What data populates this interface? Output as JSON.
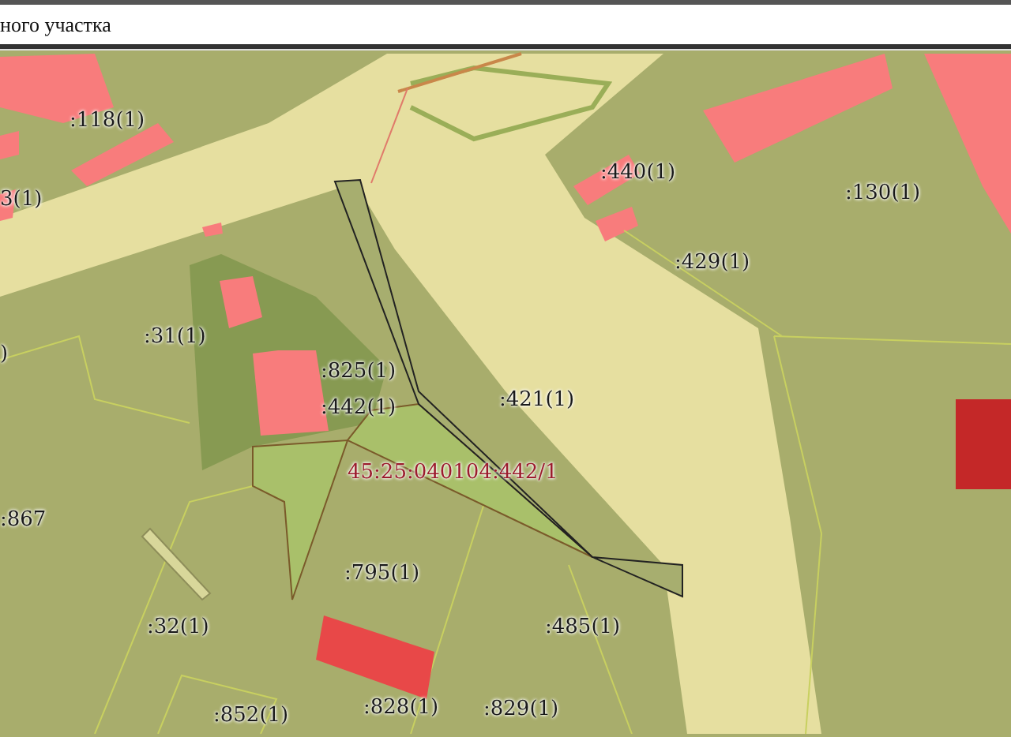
{
  "header": {
    "title": "ного участка"
  },
  "map": {
    "labels": [
      {
        "text": ":118(1)",
        "kind": "parcel"
      },
      {
        "text": "3(1)",
        "kind": "parcel"
      },
      {
        "text": ":440(1)",
        "kind": "parcel"
      },
      {
        "text": ":130(1)",
        "kind": "parcel"
      },
      {
        "text": ":429(1)",
        "kind": "parcel"
      },
      {
        "text": ":31(1)",
        "kind": "parcel"
      },
      {
        "text": ")",
        "kind": "parcel"
      },
      {
        "text": ":825(1)",
        "kind": "parcel"
      },
      {
        "text": ":442(1)",
        "kind": "parcel"
      },
      {
        "text": ":421(1)",
        "kind": "parcel"
      },
      {
        "text": "45:25:040104:442/1",
        "kind": "selected"
      },
      {
        "text": ":867",
        "kind": "parcel"
      },
      {
        "text": ":795(1)",
        "kind": "parcel"
      },
      {
        "text": ":32(1)",
        "kind": "parcel"
      },
      {
        "text": ":485(1)",
        "kind": "parcel"
      },
      {
        "text": ":852(1)",
        "kind": "parcel"
      },
      {
        "text": ":828(1)",
        "kind": "parcel"
      },
      {
        "text": ":829(1)",
        "kind": "parcel"
      }
    ]
  }
}
